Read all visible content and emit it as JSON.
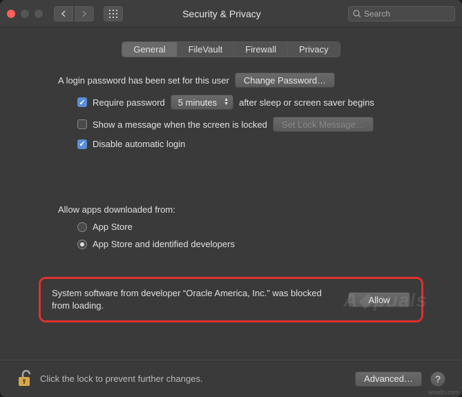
{
  "window": {
    "title": "Security & Privacy",
    "search_placeholder": "Search"
  },
  "tabs": [
    "General",
    "FileVault",
    "Firewall",
    "Privacy"
  ],
  "active_tab": 0,
  "general": {
    "password_set_text": "A login password has been set for this user",
    "change_password_label": "Change Password…",
    "require_password_label": "Require password",
    "require_password_checked": true,
    "delay_value": "5 minutes",
    "after_sleep_text": "after sleep or screen saver begins",
    "show_message_label": "Show a message when the screen is locked",
    "show_message_checked": false,
    "set_lock_message_label": "Set Lock Message…",
    "disable_auto_login_label": "Disable automatic login",
    "disable_auto_login_checked": true
  },
  "allow_apps": {
    "heading": "Allow apps downloaded from:",
    "options": [
      "App Store",
      "App Store and identified developers"
    ],
    "selected": 1
  },
  "blocked": {
    "message": "System software from developer “Oracle America, Inc.” was blocked from loading.",
    "allow_label": "Allow"
  },
  "footer": {
    "lock_text": "Click the lock to prevent further changes.",
    "advanced_label": "Advanced…"
  }
}
